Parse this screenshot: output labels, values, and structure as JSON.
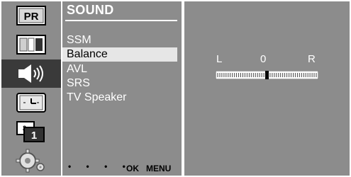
{
  "sidebar": {
    "icons": [
      {
        "name": "pr-icon",
        "label": "PR"
      },
      {
        "name": "picture-icon"
      },
      {
        "name": "sound-icon",
        "active": true
      },
      {
        "name": "time-icon"
      },
      {
        "name": "channel-icon",
        "label": "1"
      },
      {
        "name": "setup-icon"
      }
    ]
  },
  "menu": {
    "title": "SOUND",
    "items": [
      {
        "label": "SSM",
        "selected": false
      },
      {
        "label": "Balance",
        "selected": true
      },
      {
        "label": "AVL",
        "selected": false
      },
      {
        "label": "SRS",
        "selected": false
      },
      {
        "label": "TV Speaker",
        "selected": false
      }
    ],
    "footer": {
      "dots": "• • • •",
      "ok": "OK",
      "menu": "MENU"
    }
  },
  "balance": {
    "left_label": "L",
    "value": "0",
    "right_label": "R",
    "position_fraction": 0.5
  },
  "colors": {
    "panel": "#8c8c8c",
    "active_icon_bg": "#3a3a3a",
    "selected_item": "#e6e6e6",
    "text": "#ffffff"
  }
}
